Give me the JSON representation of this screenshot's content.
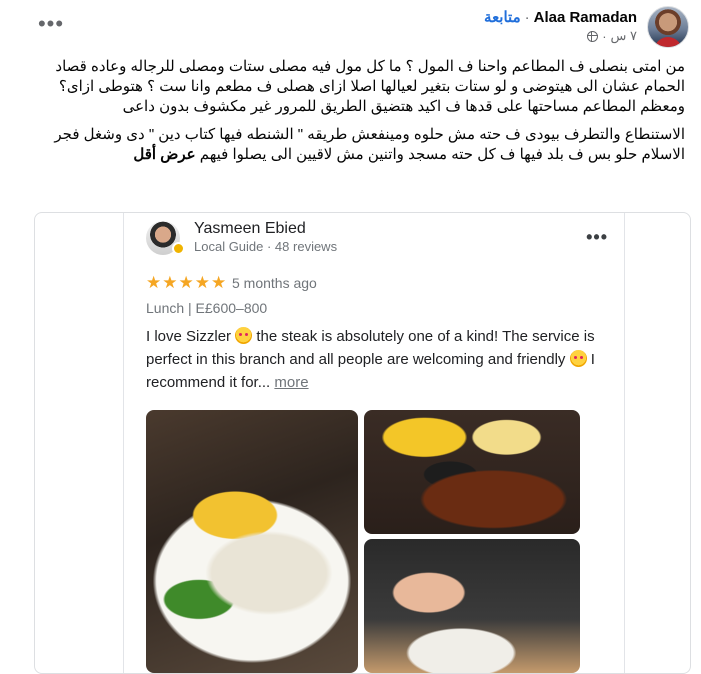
{
  "post": {
    "author": "Alaa Ramadan",
    "follow_label": "متابعة",
    "separator": "·",
    "time": "٧ س",
    "more_label": "•••",
    "paragraph1": "من امتى بنصلى ف المطاعم واحنا ف المول ؟ ما كل مول فيه مصلى  ستات ومصلى للرجاله  وعاده قصاد الحمام عشان الى هيتوضى و لو ستات بتغير لعيالها اصلا ازاى هصلى ف مطعم وانا ست ؟ هتوطى ازاى؟ ومعظم المطاعم مساحتها على قدها ف اكيد هتضيق الطريق للمرور غير مكشوف بدون داعى",
    "paragraph2": "الاستنطاع والتطرف بيودى ف حته مش حلوه ومينفعش طريقه \" الشنطه فيها كتاب دين \" دى وشغل فجر الاسلام حلو بس ف بلد فيها ف كل حته مسجد واتنين  مش لاقيين الى يصلوا فيهم",
    "see_more": "عرض أقل"
  },
  "review": {
    "name": "Yasmeen Ebied",
    "subtitle": "Local Guide · 48 reviews",
    "more_label": "•••",
    "stars": "★★★★★",
    "time": "5 months ago",
    "meta": "Lunch  |  E£600–800",
    "body_1": "I love Sizzler",
    "body_2": " the steak is absolutely one of a kind! The service is perfect in this branch and all people are welcoming and friendly",
    "body_3": " I recommend it for... ",
    "more_link": "more"
  },
  "colors": {
    "follow": "#216fdb",
    "star": "#f5a623",
    "secondary_text": "#65676b"
  },
  "icons": [
    "more-horizontal-icon",
    "globe-icon",
    "local-guide-badge-icon",
    "heart-eyes-emoji-icon"
  ]
}
